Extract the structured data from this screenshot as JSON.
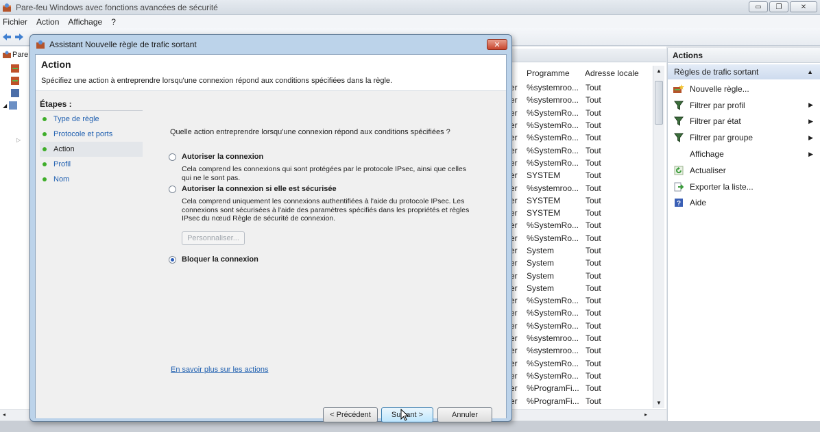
{
  "window": {
    "title": "Pare-feu Windows avec fonctions avancées de sécurité",
    "controls": {
      "minimize": "▭",
      "maximize": "❐",
      "close": "✕"
    }
  },
  "menu": [
    "Fichier",
    "Action",
    "Affichage",
    "?"
  ],
  "tree": {
    "root_label": "Pare"
  },
  "rules_list": {
    "columns": [
      "Programme",
      "Adresse locale"
    ],
    "rows": [
      {
        "prefix": "er",
        "program": "%systemroo...",
        "address": "Tout"
      },
      {
        "prefix": "er",
        "program": "%systemroo...",
        "address": "Tout"
      },
      {
        "prefix": "er",
        "program": "%SystemRo...",
        "address": "Tout"
      },
      {
        "prefix": "er",
        "program": "%SystemRo...",
        "address": "Tout"
      },
      {
        "prefix": "er",
        "program": "%SystemRo...",
        "address": "Tout"
      },
      {
        "prefix": "er",
        "program": "%SystemRo...",
        "address": "Tout"
      },
      {
        "prefix": "er",
        "program": "%SystemRo...",
        "address": "Tout"
      },
      {
        "prefix": "er",
        "program": "SYSTEM",
        "address": "Tout"
      },
      {
        "prefix": "er",
        "program": "%systemroo...",
        "address": "Tout"
      },
      {
        "prefix": "er",
        "program": "SYSTEM",
        "address": "Tout"
      },
      {
        "prefix": "er",
        "program": "SYSTEM",
        "address": "Tout"
      },
      {
        "prefix": "er",
        "program": "%SystemRo...",
        "address": "Tout"
      },
      {
        "prefix": "er",
        "program": "%SystemRo...",
        "address": "Tout"
      },
      {
        "prefix": "er",
        "program": "System",
        "address": "Tout"
      },
      {
        "prefix": "er",
        "program": "System",
        "address": "Tout"
      },
      {
        "prefix": "er",
        "program": "System",
        "address": "Tout"
      },
      {
        "prefix": "er",
        "program": "System",
        "address": "Tout"
      },
      {
        "prefix": "er",
        "program": "%SystemRo...",
        "address": "Tout"
      },
      {
        "prefix": "er",
        "program": "%SystemRo...",
        "address": "Tout"
      },
      {
        "prefix": "er",
        "program": "%SystemRo...",
        "address": "Tout"
      },
      {
        "prefix": "er",
        "program": "%systemroo...",
        "address": "Tout"
      },
      {
        "prefix": "er",
        "program": "%systemroo...",
        "address": "Tout"
      },
      {
        "prefix": "er",
        "program": "%SystemRo...",
        "address": "Tout"
      },
      {
        "prefix": "er",
        "program": "%SystemRo...",
        "address": "Tout"
      },
      {
        "prefix": "er",
        "program": "%ProgramFi...",
        "address": "Tout"
      },
      {
        "prefix": "er",
        "program": "%ProgramFi...",
        "address": "Tout"
      }
    ]
  },
  "actions_pane": {
    "header": "Actions",
    "section": "Règles de trafic sortant",
    "items": [
      {
        "label": "Nouvelle règle...",
        "icon": "new-rule-icon",
        "submenu": false
      },
      {
        "label": "Filtrer par profil",
        "icon": "filter-icon",
        "submenu": true
      },
      {
        "label": "Filtrer par état",
        "icon": "filter-icon",
        "submenu": true
      },
      {
        "label": "Filtrer par groupe",
        "icon": "filter-icon",
        "submenu": true
      },
      {
        "label": "Affichage",
        "icon": "",
        "submenu": true
      },
      {
        "label": "Actualiser",
        "icon": "refresh-icon",
        "submenu": false
      },
      {
        "label": "Exporter la liste...",
        "icon": "export-icon",
        "submenu": false
      },
      {
        "label": "Aide",
        "icon": "help-icon",
        "submenu": false
      }
    ]
  },
  "dialog": {
    "title": "Assistant Nouvelle règle de trafic sortant",
    "close": "✕",
    "header_title": "Action",
    "header_subtitle": "Spécifiez une action à entreprendre lorsqu'une connexion répond aux conditions spécifiées dans la règle.",
    "steps_title": "Étapes :",
    "steps": [
      "Type de règle",
      "Protocole et ports",
      "Action",
      "Profil",
      "Nom"
    ],
    "active_step": 2,
    "question": "Quelle action entreprendre lorsqu'une connexion répond aux conditions spécifiées ?",
    "options": [
      {
        "label": "Autoriser la connexion",
        "desc": "Cela comprend les connexions qui sont protégées par le protocole IPsec, ainsi que celles qui ne le sont pas.",
        "checked": false
      },
      {
        "label": "Autoriser la connexion si elle est sécurisée",
        "desc": "Cela comprend uniquement les connexions authentifiées à l'aide du protocole IPsec. Les connexions sont sécurisées à l'aide des paramètres spécifiés dans les propriétés et règles IPsec du nœud Règle de sécurité de connexion.",
        "checked": false
      },
      {
        "label": "Bloquer la connexion",
        "desc": "",
        "checked": true
      }
    ],
    "customize_button": "Personnaliser...",
    "learn_more_link": "En savoir plus sur les actions",
    "buttons": {
      "back": "< Précédent",
      "next": "Suivant >",
      "cancel": "Annuler"
    }
  },
  "colors": {
    "accent": "#2060b0",
    "step_dot": "#3fae2a",
    "dialog_frame": "#bcd3ea"
  }
}
